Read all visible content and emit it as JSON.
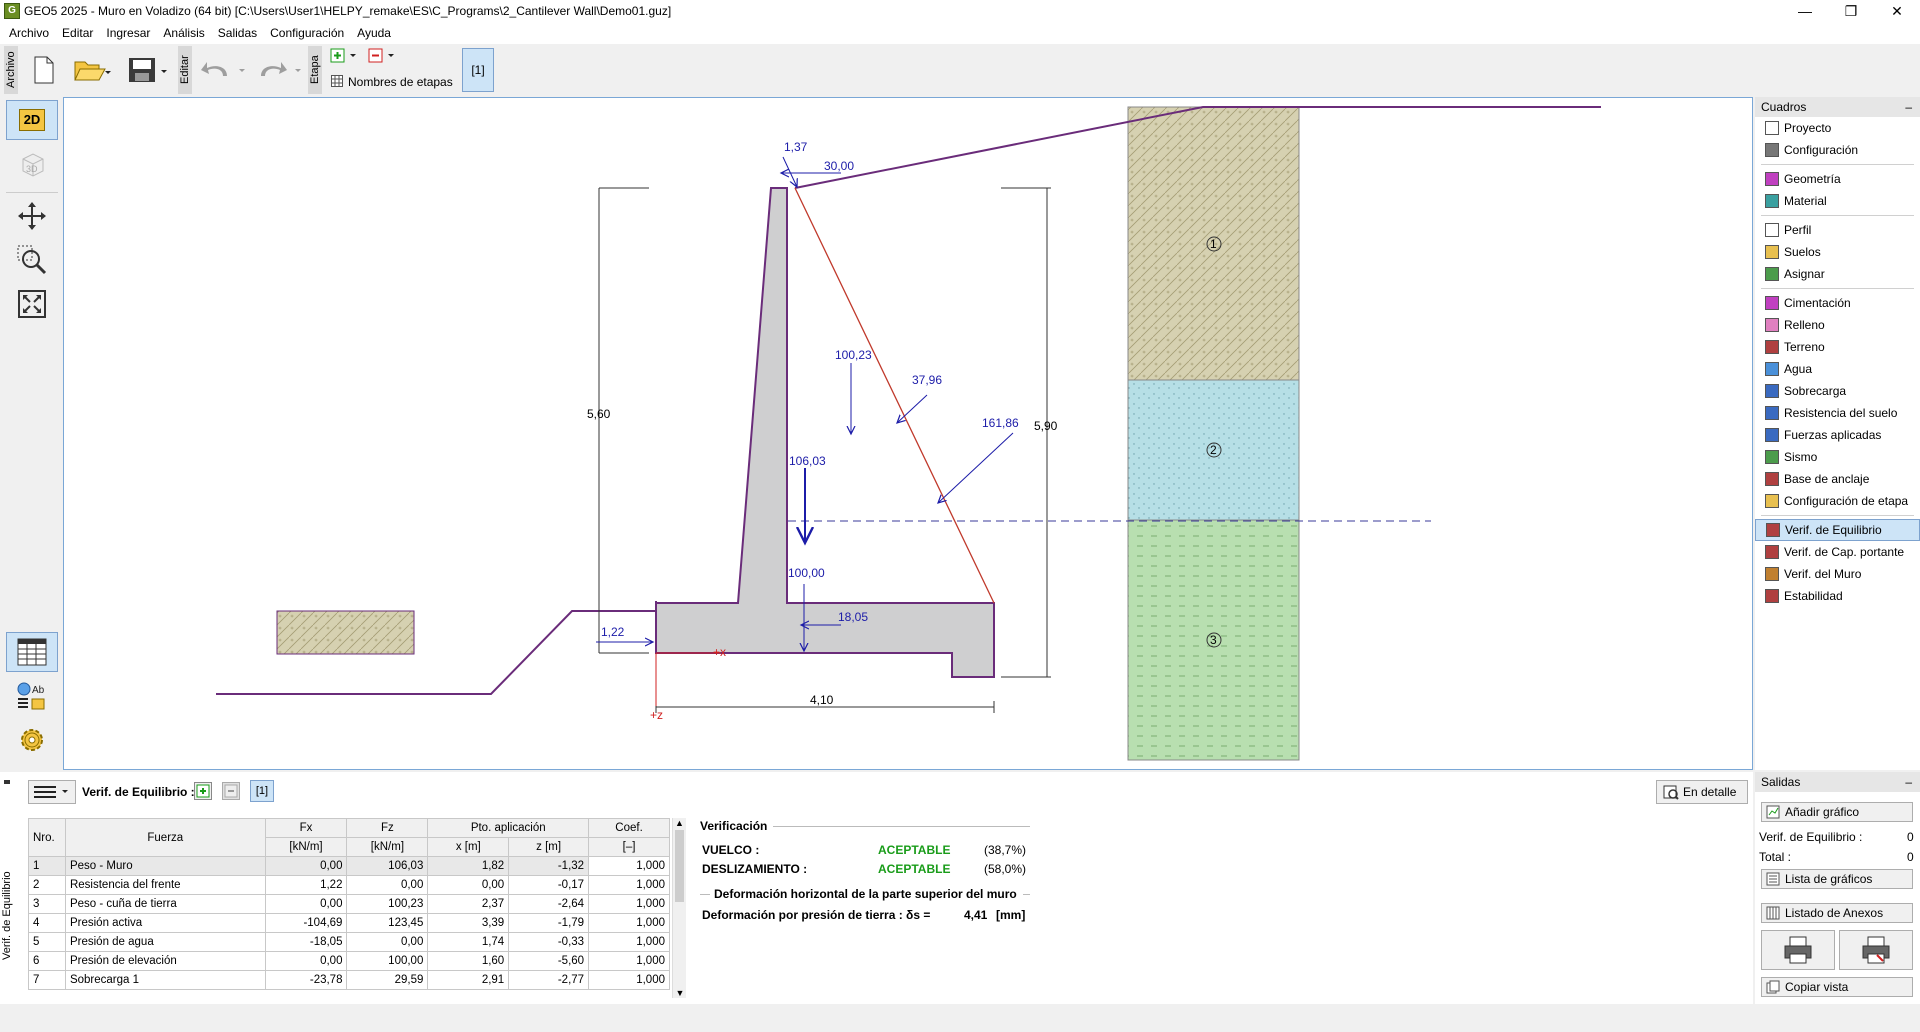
{
  "window": {
    "title": "GEO5 2025 - Muro en Voladizo (64 bit) [C:\\Users\\User1\\HELPY_remake\\ES\\C_Programs\\2_Cantilever Wall\\Demo01.guz]",
    "app_icon_text": "G",
    "minimize": "—",
    "restore": "❐",
    "close": "✕"
  },
  "menu": [
    "Archivo",
    "Editar",
    "Ingresar",
    "Análisis",
    "Salidas",
    "Configuración",
    "Ayuda"
  ],
  "toolbar": {
    "archivo_label": "Archivo",
    "editar_label": "Editar",
    "etapa_label": "Etapa",
    "stage_names_label": "Nombres de etapas",
    "stage_button": "[1]"
  },
  "left_toolbar": {
    "view_2d": "2D",
    "view_3d": "3D",
    "mode_ab": "Ab"
  },
  "canvas": {
    "dims": {
      "height_left": "5,60",
      "height_right": "5,90",
      "width_bottom": "4,10",
      "toe": "1,22"
    },
    "forces": {
      "f137": "1,37",
      "f3000": "30,00",
      "f10023": "100,23",
      "f3796": "37,96",
      "f16186": "161,86",
      "f10603": "106,03",
      "f10000": "100,00",
      "f1805": "18,05"
    },
    "axis": {
      "x": "+x",
      "z": "+z"
    },
    "layers": [
      "1",
      "2",
      "3"
    ],
    "colors": {
      "wall": "#cfcfd0",
      "wall_outline": "#6a2c7a",
      "force": "#1c1ca8",
      "soil1": "#d6d1b1",
      "soil2": "#b6dfe6",
      "soil3": "#b8dfb0",
      "earth_wedge": "#c0392b"
    }
  },
  "right_panel": {
    "header": "Cuadros",
    "collapse": "–",
    "groups": [
      [
        {
          "label": "Proyecto",
          "icon": "document-icon"
        },
        {
          "label": "Configuración",
          "icon": "gear-icon"
        }
      ],
      [
        {
          "label": "Geometría",
          "icon": "geometry-icon"
        },
        {
          "label": "Material",
          "icon": "material-icon"
        }
      ],
      [
        {
          "label": "Perfil",
          "icon": "profile-icon"
        },
        {
          "label": "Suelos",
          "icon": "soils-icon"
        },
        {
          "label": "Asignar",
          "icon": "assign-icon"
        }
      ],
      [
        {
          "label": "Cimentación",
          "icon": "foundation-icon"
        },
        {
          "label": "Relleno",
          "icon": "backfill-icon"
        },
        {
          "label": "Terreno",
          "icon": "terrain-icon"
        },
        {
          "label": "Agua",
          "icon": "water-icon"
        },
        {
          "label": "Sobrecarga",
          "icon": "surcharge-icon"
        },
        {
          "label": "Resistencia del suelo",
          "icon": "resistance-icon"
        },
        {
          "label": "Fuerzas aplicadas",
          "icon": "forces-icon"
        },
        {
          "label": "Sismo",
          "icon": "earthquake-icon"
        },
        {
          "label": "Base de anclaje",
          "icon": "anchor-icon"
        },
        {
          "label": "Configuración de etapa",
          "icon": "stage-config-icon"
        }
      ],
      [
        {
          "label": "Verif. de Equilibrio",
          "icon": "equilibrium-icon",
          "active": true
        },
        {
          "label": "Verif. de Cap. portante",
          "icon": "bearing-icon"
        },
        {
          "label": "Verif. del Muro",
          "icon": "wall-check-icon"
        },
        {
          "label": "Estabilidad",
          "icon": "stability-icon"
        }
      ]
    ]
  },
  "bottom": {
    "side_label": "Verif. de Equilibrio",
    "section_label": "Verif. de Equilibrio :",
    "stage_tag": "[1]",
    "detail_button": "En detalle",
    "table": {
      "headers": {
        "nro": "Nro.",
        "fuerza": "Fuerza",
        "fx": "Fx",
        "fz": "Fz",
        "pto": "Pto. aplicación",
        "coef": "Coef.",
        "fx_unit": "[kN/m]",
        "fz_unit": "[kN/m]",
        "x_unit": "x [m]",
        "z_unit": "z [m]",
        "coef_unit": "[–]"
      },
      "rows": [
        [
          "1",
          "Peso - Muro",
          "0,00",
          "106,03",
          "1,82",
          "-1,32",
          "1,000"
        ],
        [
          "2",
          "Resistencia del frente",
          "1,22",
          "0,00",
          "0,00",
          "-0,17",
          "1,000"
        ],
        [
          "3",
          "Peso - cuña de tierra",
          "0,00",
          "100,23",
          "2,37",
          "-2,64",
          "1,000"
        ],
        [
          "4",
          "Presión activa",
          "-104,69",
          "123,45",
          "3,39",
          "-1,79",
          "1,000"
        ],
        [
          "5",
          "Presión de agua",
          "-18,05",
          "0,00",
          "1,74",
          "-0,33",
          "1,000"
        ],
        [
          "6",
          "Presión de elevación",
          "0,00",
          "100,00",
          "1,60",
          "-5,60",
          "1,000"
        ],
        [
          "7",
          "Sobrecarga 1",
          "-23,78",
          "29,59",
          "2,91",
          "-2,77",
          "1,000"
        ]
      ]
    },
    "verification": {
      "title": "Verificación",
      "vuelco_label": "VUELCO :",
      "vuelco_result": "ACEPTABLE",
      "vuelco_pct": "(38,7%)",
      "desl_label": "DESLIZAMIENTO :",
      "desl_result": "ACEPTABLE",
      "desl_pct": "(58,0%)",
      "deform_title": "Deformación horizontal de la parte superior del muro",
      "deform_label": "Deformación por presión de tierra : δs =",
      "deform_value": "4,41",
      "deform_unit": "[mm]"
    }
  },
  "outputs": {
    "header": "Salidas",
    "collapse": "–",
    "add_graph": "Añadir gráfico",
    "eq_label": "Verif. de Equilibrio :",
    "eq_count": "0",
    "total_label": "Total :",
    "total_count": "0",
    "graph_list": "Lista de gráficos",
    "annex_list": "Listado de Anexos",
    "copy_view": "Copiar vista"
  }
}
